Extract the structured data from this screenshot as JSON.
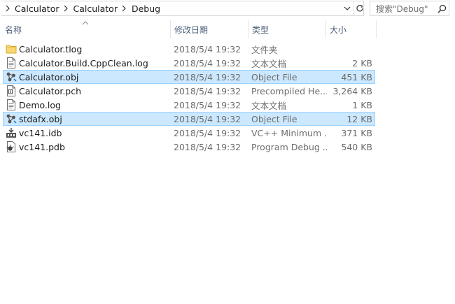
{
  "address": {
    "breadcrumbs": [
      "Calculator",
      "Calculator",
      "Debug"
    ],
    "search_placeholder": "搜索\"Debug\""
  },
  "columns": {
    "name": "名称",
    "date": "修改日期",
    "type": "类型",
    "size": "大小"
  },
  "files": [
    {
      "name": "Calculator.tlog",
      "date": "2018/5/4 19:32",
      "type": "文件夹",
      "size": "",
      "icon": "folder-icon",
      "selected": false
    },
    {
      "name": "Calculator.Build.CppClean.log",
      "date": "2018/5/4 19:32",
      "type": "文本文档",
      "size": "2 KB",
      "icon": "text-file-icon",
      "selected": false
    },
    {
      "name": "Calculator.obj",
      "date": "2018/5/4 19:32",
      "type": "Object File",
      "size": "451 KB",
      "icon": "object-file-icon",
      "selected": true
    },
    {
      "name": "Calculator.pch",
      "date": "2018/5/4 19:32",
      "type": "Precompiled He...",
      "size": "3,264 KB",
      "icon": "precompiled-header-icon",
      "selected": false
    },
    {
      "name": "Demo.log",
      "date": "2018/5/4 19:32",
      "type": "文本文档",
      "size": "1 KB",
      "icon": "text-file-icon",
      "selected": false
    },
    {
      "name": "stdafx.obj",
      "date": "2018/5/4 19:32",
      "type": "Object File",
      "size": "12 KB",
      "icon": "object-file-icon",
      "selected": true
    },
    {
      "name": "vc141.idb",
      "date": "2018/5/4 19:32",
      "type": "VC++ Minimum ...",
      "size": "371 KB",
      "icon": "idb-file-icon",
      "selected": false
    },
    {
      "name": "vc141.pdb",
      "date": "2018/5/4 19:32",
      "type": "Program Debug ...",
      "size": "540 KB",
      "icon": "pdb-file-icon",
      "selected": false
    }
  ]
}
